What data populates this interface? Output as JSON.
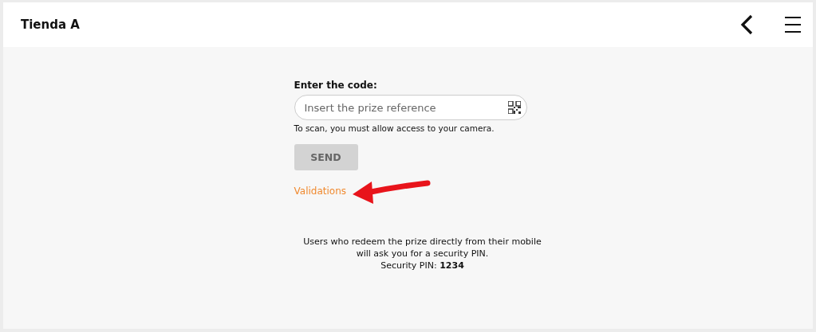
{
  "header": {
    "title": "Tienda A"
  },
  "form": {
    "label": "Enter the code:",
    "placeholder": "Insert the prize reference",
    "hint": "To scan, you must allow access to your camera.",
    "button": {
      "label": "SEND",
      "disabled": true
    },
    "link": "Validations"
  },
  "notice": {
    "lines": [
      "Users who redeem the prize directly from their mobile",
      "will ask you for a security PIN.",
      "Security PIN: **1234**"
    ]
  }
}
